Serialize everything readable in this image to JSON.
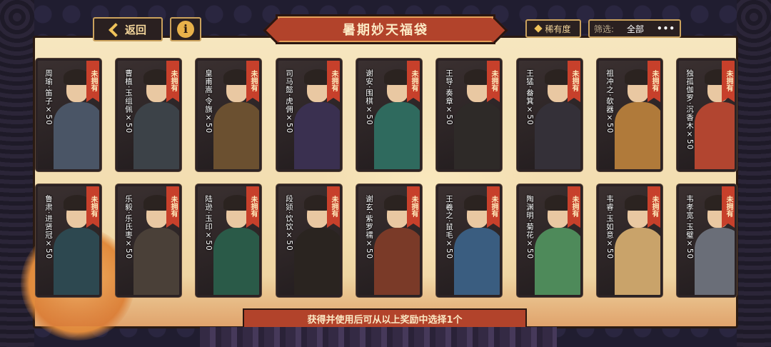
{
  "header": {
    "back_label": "返回",
    "info_icon": "i",
    "title": "暑期妙天福袋",
    "rarity_label": "稀有度",
    "filter_label": "筛选:",
    "filter_value": "全部",
    "more_icon": "•••"
  },
  "status_label": "未拥有",
  "cards": [
    {
      "name": "周瑜·笛子×50",
      "body": "#4a5566"
    },
    {
      "name": "曹植·玉组佩×50",
      "body": "#3c4248"
    },
    {
      "name": "皇甫嵩·令旗×50",
      "body": "#6b5030"
    },
    {
      "name": "司马懿·虎佣×50",
      "body": "#3a3050"
    },
    {
      "name": "谢安·围棋×50",
      "body": "#2f6a5e"
    },
    {
      "name": "王导·奏章×50",
      "body": "#2e2a28"
    },
    {
      "name": "王猛·畚箕×50",
      "body": "#343038"
    },
    {
      "name": "祖冲之·欹器×50",
      "body": "#b07a3a"
    },
    {
      "name": "独孤伽罗·沉香木×50",
      "body": "#b24530"
    },
    {
      "name": "鲁肃·进贤冠×50",
      "body": "#2d4850"
    },
    {
      "name": "乐毅·乐氏枣×50",
      "body": "#4a4038"
    },
    {
      "name": "陆逊·玉印×50",
      "body": "#2a5a48"
    },
    {
      "name": "段颎·饮饮×50",
      "body": "#2a2420"
    },
    {
      "name": "谢玄·紫罗襦×50",
      "body": "#7a3a28"
    },
    {
      "name": "王羲之·鼠毛×50",
      "body": "#3a5d80"
    },
    {
      "name": "陶渊明·菊花×50",
      "body": "#4e8a5a"
    },
    {
      "name": "韦睿·玉如意×50",
      "body": "#c9a36a"
    },
    {
      "name": "韦孝宽·玉璧×50",
      "body": "#6a6e78"
    }
  ],
  "footer": {
    "note": "获得并使用后可从以上奖励中选择1个"
  },
  "colors": {
    "accent_red": "#b2432b",
    "panel": "#f2dcae",
    "frame": "#2a1a12"
  }
}
